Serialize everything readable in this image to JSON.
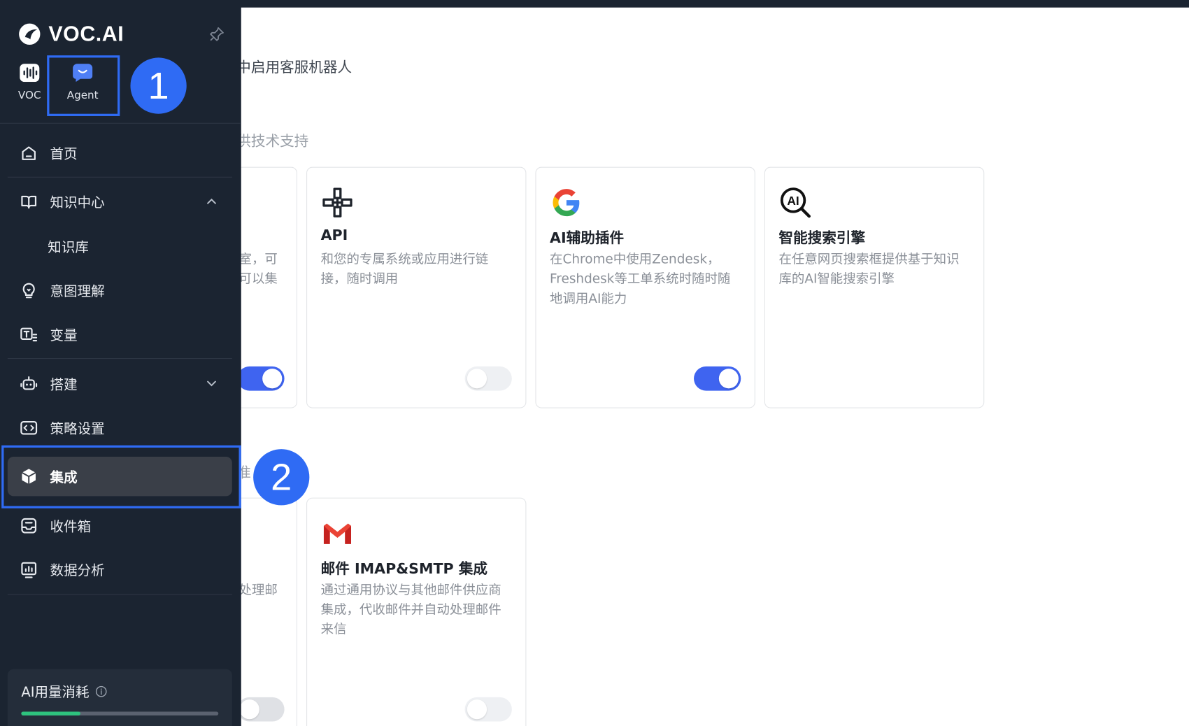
{
  "brand": {
    "name": "VOC.AI"
  },
  "apps": [
    {
      "label": "VOC",
      "icon": "voc-wave-icon"
    },
    {
      "label": "Agent",
      "icon": "agent-chat-icon"
    }
  ],
  "nav": {
    "home": "首页",
    "knowledge_center": "知识中心",
    "knowledge_base": "知识库",
    "intent": "意图理解",
    "variables": "变量",
    "build": "搭建",
    "strategy": "策略设置",
    "integration": "集成",
    "inbox": "收件箱",
    "analytics": "数据分析"
  },
  "usage": {
    "title": "AI用量消耗",
    "progress_percent": 30
  },
  "annotations": {
    "step1": "1",
    "step2": "2"
  },
  "main": {
    "section1_desc": "中启用客服机器人",
    "section2_desc": "供技术支持",
    "partial_card1_text": [
      "室，可",
      "可以集"
    ],
    "partial_card2_text": "处理邮",
    "partial_section3_char": "准",
    "cards_row1": [
      {
        "icon": "api-link-icon",
        "title": "API",
        "desc": "和您的专属系统或应用进行链接，随时调用",
        "toggle_on": false
      },
      {
        "icon": "google-icon",
        "title": "AI辅助插件",
        "desc": "在Chrome中使用Zendesk，Freshdesk等工单系统时随时随地调用AI能力",
        "toggle_on": true
      },
      {
        "icon": "ai-search-icon",
        "title": "智能搜索引擎",
        "desc": "在任意网页搜索框提供基于知识库的AI智能搜索引擎"
      }
    ],
    "cards_row2": [
      {
        "icon": "gmail-icon",
        "title": "邮件 IMAP&SMTP 集成",
        "desc": "通过通用协议与其他邮件供应商集成，代收邮件并自动处理邮件来信",
        "toggle_on": false
      }
    ]
  },
  "colors": {
    "sidebar_bg": "#1b2431",
    "accent_blue": "#2f6bf4",
    "toggle_on": "#3f64f0",
    "usage_green": "#2ec27e"
  }
}
